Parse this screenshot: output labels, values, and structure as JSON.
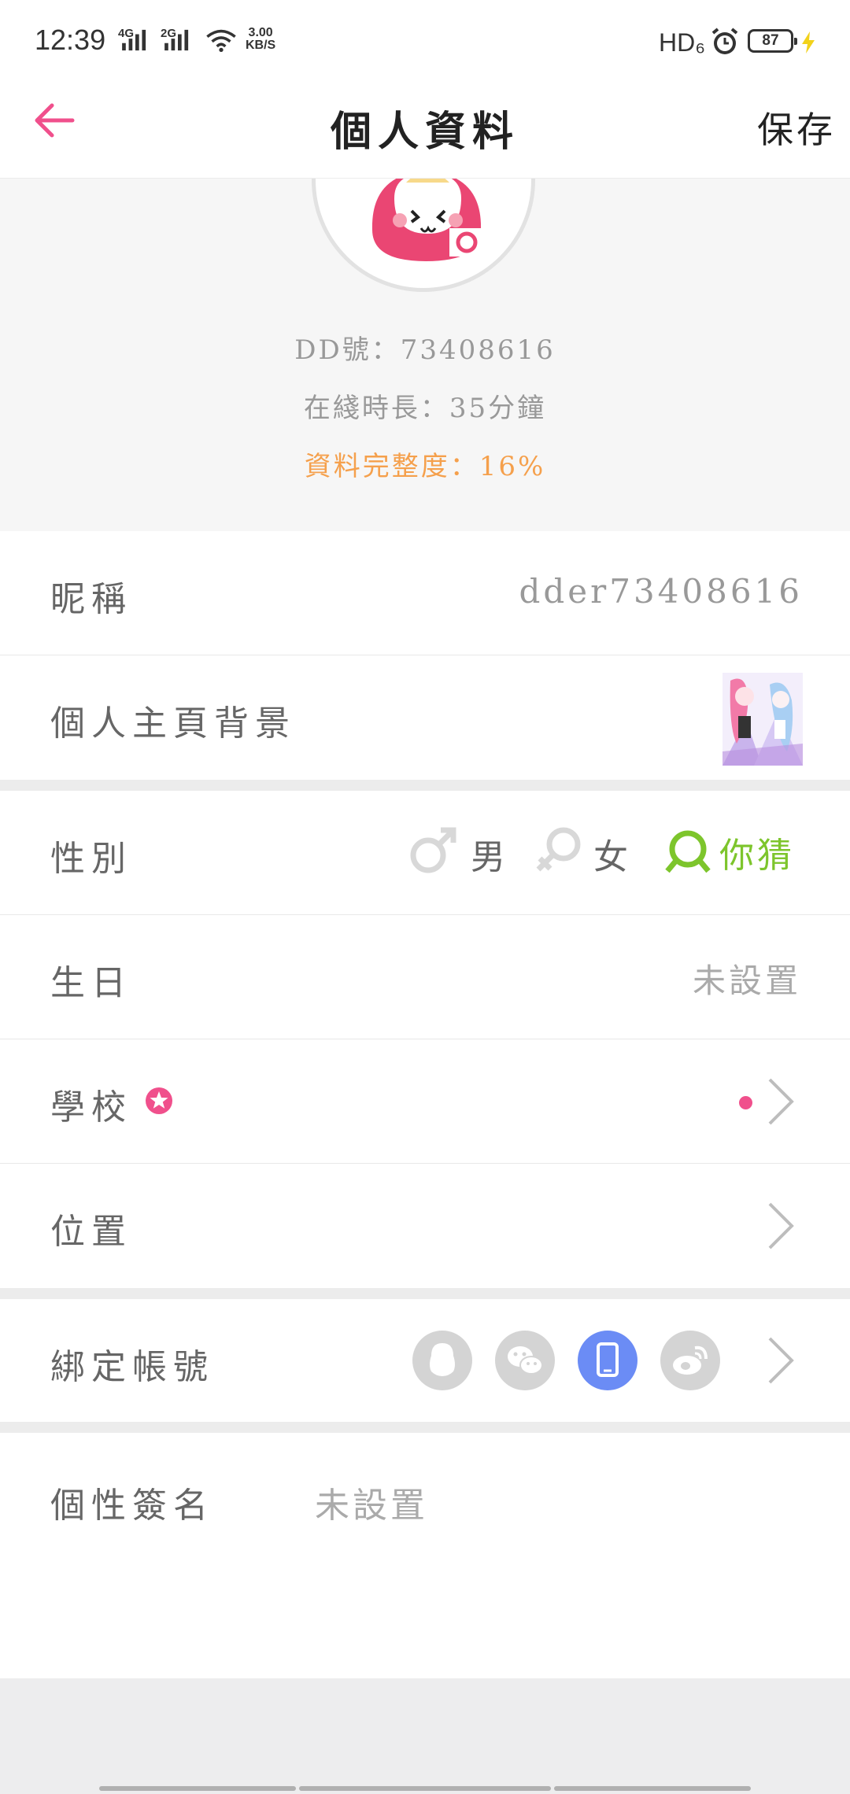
{
  "status_bar": {
    "time": "12:39",
    "net1": "4G",
    "net2": "2G",
    "speed_value": "3.00",
    "speed_unit": "KB/S",
    "hd": "HD₆",
    "battery": "87"
  },
  "nav": {
    "title": "個人資料",
    "save_label": "保存",
    "accent_color": "#f0508c"
  },
  "profile": {
    "dd_number": "DD號：73408616",
    "online_time": "在綫時長：35分鐘",
    "completeness": "資料完整度：16%"
  },
  "rows": {
    "nickname": {
      "label": "昵稱",
      "value": "dder73408616"
    },
    "background": {
      "label": "個人主頁背景"
    },
    "gender": {
      "label": "性別",
      "options": [
        {
          "label": "男",
          "icon": "male-icon",
          "selected": false
        },
        {
          "label": "女",
          "icon": "female-icon",
          "selected": false
        },
        {
          "label": "你猜",
          "icon": "unknown-gender-icon",
          "selected": true
        }
      ],
      "selected_color": "#7dc52c"
    },
    "birthday": {
      "label": "生日",
      "value": "未設置"
    },
    "school": {
      "label": "學校"
    },
    "location": {
      "label": "位置"
    },
    "bind_account": {
      "label": "綁定帳號",
      "icons": [
        "qq-icon",
        "wechat-icon",
        "phone-icon",
        "weibo-icon"
      ],
      "active": "phone-icon",
      "active_color": "#6b8cf5"
    },
    "signature": {
      "label": "個性簽名",
      "value": "未設置"
    }
  }
}
